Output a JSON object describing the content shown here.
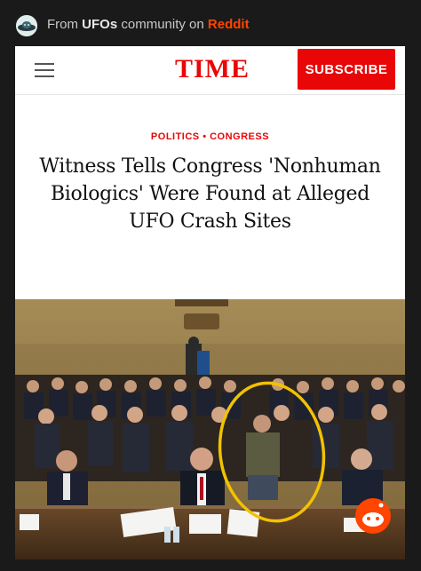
{
  "topbar": {
    "prefix": "From",
    "community": "UFOs",
    "middle": "community on",
    "platform": "Reddit",
    "icon": "alien-subreddit-icon"
  },
  "header": {
    "logo": "TIME",
    "subscribe_label": "SUBSCRIBE",
    "menu_icon": "hamburger-menu-icon"
  },
  "article": {
    "category": "POLITICS • CONGRESS",
    "headline": "Witness Tells Congress 'Nonhuman Biologics' Were Found at Alleged UFO Crash Sites"
  },
  "colors": {
    "time_red": "#e90606",
    "reddit_orange": "#ff4500",
    "highlight_circle": "#f2c200"
  }
}
